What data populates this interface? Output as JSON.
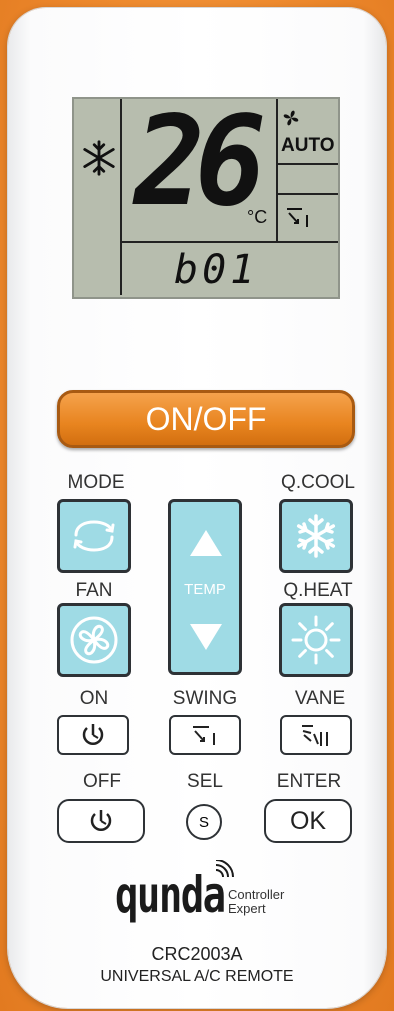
{
  "lcd": {
    "temperature": "26",
    "unit": "°C",
    "fan_mode": "AUTO",
    "code": "b01",
    "mode_icon": "snowflake-icon",
    "fan_icon": "fan-icon",
    "swing_icon": "swing-icon"
  },
  "buttons": {
    "power": "ON/OFF",
    "mode_label": "MODE",
    "qcool_label": "Q.COOL",
    "fan_label": "FAN",
    "qheat_label": "Q.HEAT",
    "temp_label": "TEMP",
    "on_label": "ON",
    "swing_label": "SWING",
    "vane_label": "VANE",
    "off_label": "OFF",
    "sel_label": "SEL",
    "enter_label": "ENTER",
    "sel_key": "S",
    "ok_key": "OK"
  },
  "branding": {
    "logo": "qunda",
    "sub1": "Controller",
    "sub2": "Expert",
    "model": "CRC2003A",
    "description": "UNIVERSAL A/C REMOTE"
  },
  "colors": {
    "background": "#ee8a2e",
    "power_button": "#e8841f",
    "keys": "#9fdbe5",
    "lcd": "#b7bdae"
  }
}
